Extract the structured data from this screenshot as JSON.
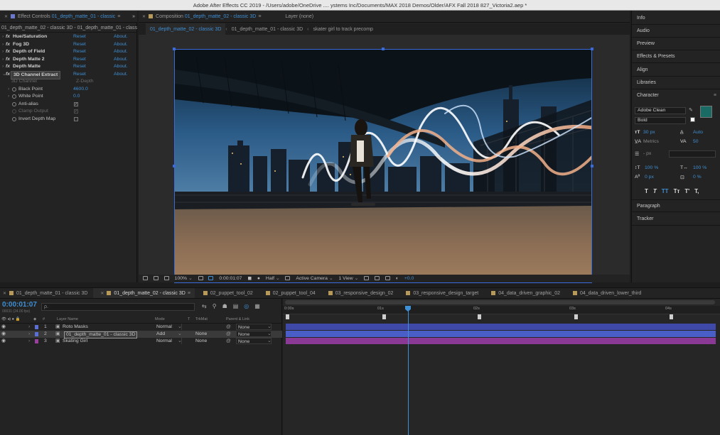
{
  "window": {
    "title": "Adobe After Effects CC 2019 - /Users/adobe/OneDrive .... ystems Inc/Documents/MAX 2018 Demos/Older/AFX Fall 2018 827_Victoria2.aep *"
  },
  "effect_controls": {
    "tab_label": "Effect Controls",
    "tab_target": "01_depth_matte_01 - classic",
    "subtitle": "01_depth_matte_02 - classic 3D - 01_depth_matte_01 - classic",
    "effects": [
      {
        "name": "Hue/Saturation",
        "reset": "Reset",
        "about": "About."
      },
      {
        "name": "Fog 3D",
        "reset": "Reset",
        "about": "About."
      },
      {
        "name": "Depth of Field",
        "reset": "Reset",
        "about": "About."
      },
      {
        "name": "Depth Matte 2",
        "reset": "Reset",
        "about": "About."
      },
      {
        "name": "Depth Matte",
        "reset": "Reset",
        "about": "About."
      },
      {
        "name": "3D Channel Extract",
        "reset": "Reset",
        "about": "About."
      }
    ],
    "props": [
      {
        "name": "3D Channel",
        "value": "Z-Depth"
      },
      {
        "name": "Black Point",
        "value": "4600.0"
      },
      {
        "name": "White Point",
        "value": "0.0"
      },
      {
        "name": "Anti-alias",
        "value": "✓"
      },
      {
        "name": "Clamp Output",
        "value": "✓"
      },
      {
        "name": "Invert Depth Map",
        "value": ""
      }
    ]
  },
  "composition": {
    "tab_label": "Composition",
    "tab_target": "01_depth_matte_02 - classic 3D",
    "layer_tab": "Layer (none)",
    "breadcrumbs": [
      "01_depth_matte_02 - classic 3D",
      "01_depth_matte_01 - classic 3D",
      "skater girl to track precomp"
    ],
    "viewer_bar": {
      "zoom": "100%",
      "time": "0:00:01:07",
      "resolution": "Half",
      "camera": "Active Camera",
      "views": "1 View",
      "exposure": "+0.0"
    }
  },
  "right_panels": {
    "top": [
      "Info",
      "Audio",
      "Preview",
      "Effects & Presets",
      "Align",
      "Libraries"
    ],
    "character": {
      "title": "Character",
      "font": "Adobe Clean",
      "style": "Bold",
      "size": "30 px",
      "leading": "Auto",
      "kerning": "Metrics",
      "tracking": "50",
      "stroke_unit": "- px",
      "vscale": "100 %",
      "hscale": "100 %",
      "baseline": "0 px",
      "tsume": "0 %",
      "styles": [
        "T",
        "T",
        "TT",
        "Tт",
        "T'",
        "T,"
      ],
      "fill_color": "#1a6b64",
      "stroke_color": "#ffffff"
    },
    "bottom": [
      "Paragraph",
      "Tracker"
    ]
  },
  "timeline": {
    "tabs": [
      "01_depth_matte_01 - classic 3D",
      "01_depth_matte_02 - classic 3D",
      "02_puppet_tool_02",
      "02_puppet_tool_04",
      "03_responsive_design_02",
      "03_responsive_design_target",
      "04_data_driven_graphic_02",
      "04_data_driven_lower_third"
    ],
    "active_tab": 1,
    "timecode": "0:00:01:07",
    "fps": "00031 (24.00 fps)",
    "search_placeholder": "ρ.",
    "headers": {
      "layer_name": "Layer Name",
      "mode": "Mode",
      "t": "T",
      "trkmat": "TrkMat",
      "parent": "Parent & Link"
    },
    "layers": [
      {
        "num": "1",
        "name": "Roto Masks",
        "mode": "Normal",
        "trkmat": "",
        "parent": "None",
        "color": "#5b6fd6"
      },
      {
        "num": "2",
        "name": "01_depth_matte_01 - classic 3D",
        "mode": "Add",
        "trkmat": "None",
        "parent": "None",
        "color": "#5b6fd6"
      },
      {
        "num": "3",
        "name": "Skating Girl",
        "mode": "Normal",
        "trkmat": "None",
        "parent": "None",
        "color": "#9a3ea0"
      }
    ],
    "ruler": [
      "0:00s",
      "01s",
      "02s",
      "03s",
      "04s"
    ],
    "bar_colors": [
      "#3e49a8",
      "#4a5ec8",
      "#8a3a95"
    ]
  }
}
